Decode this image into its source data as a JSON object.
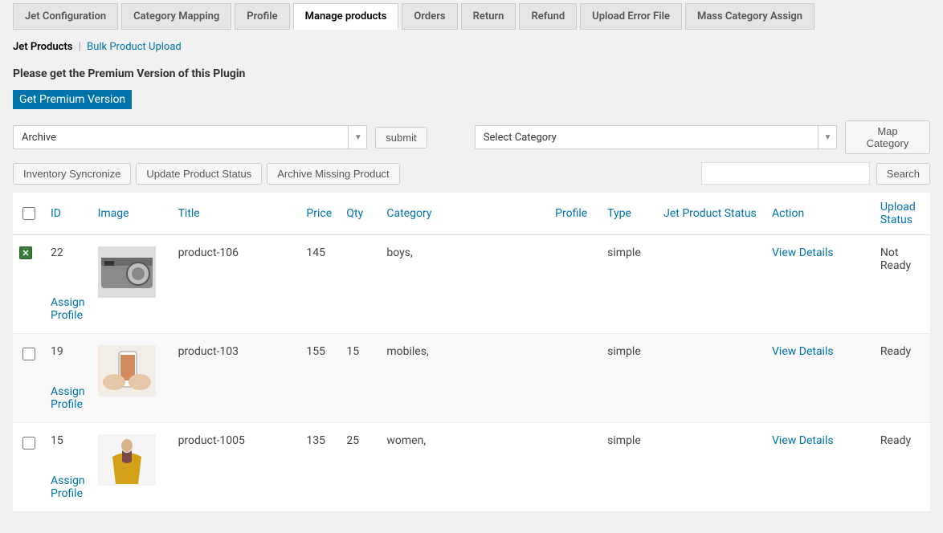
{
  "tabs": [
    "Jet Configuration",
    "Category Mapping",
    "Profile",
    "Manage products",
    "Orders",
    "Return",
    "Refund",
    "Upload Error File",
    "Mass Category Assign"
  ],
  "active_tab_index": 3,
  "subnav": {
    "current": "Jet Products",
    "link": "Bulk Product Upload"
  },
  "premium_msg": "Please get the Premium Version of this Plugin",
  "premium_btn": "Get Premium Version",
  "bulk_select": {
    "value": "Archive"
  },
  "submit_btn": "submit",
  "category_select": {
    "value": "Select Category"
  },
  "map_category_btn": "Map Category",
  "action_buttons": [
    "Inventory Syncronize",
    "Update Product Status",
    "Archive Missing Product"
  ],
  "search_btn": "Search",
  "columns": {
    "id": "ID",
    "image": "Image",
    "title": "Title",
    "price": "Price",
    "qty": "Qty",
    "category": "Category",
    "profile": "Profile",
    "type": "Type",
    "jet_status": "Jet Product Status",
    "action": "Action",
    "upload_status": "Upload Status"
  },
  "action_link": "View Details",
  "assign_profile": "Assign Profile",
  "rows": [
    {
      "id": "22",
      "title": "product-106",
      "price": "145",
      "qty": "",
      "category": "boys,",
      "profile": "",
      "type": "simple",
      "jet_status": "",
      "upload_status": "Not Ready",
      "status_class": "notready",
      "thumb": "camera",
      "checked_icon": true
    },
    {
      "id": "19",
      "title": "product-103",
      "price": "155",
      "qty": "15",
      "category": "mobiles,",
      "profile": "",
      "type": "simple",
      "jet_status": "",
      "upload_status": "Ready",
      "status_class": "ready",
      "thumb": "phone",
      "checked_icon": false
    },
    {
      "id": "15",
      "title": "product-1005",
      "price": "135",
      "qty": "25",
      "category": "women,",
      "profile": "",
      "type": "simple",
      "jet_status": "",
      "upload_status": "Ready",
      "status_class": "ready",
      "thumb": "coat",
      "checked_icon": false
    }
  ]
}
